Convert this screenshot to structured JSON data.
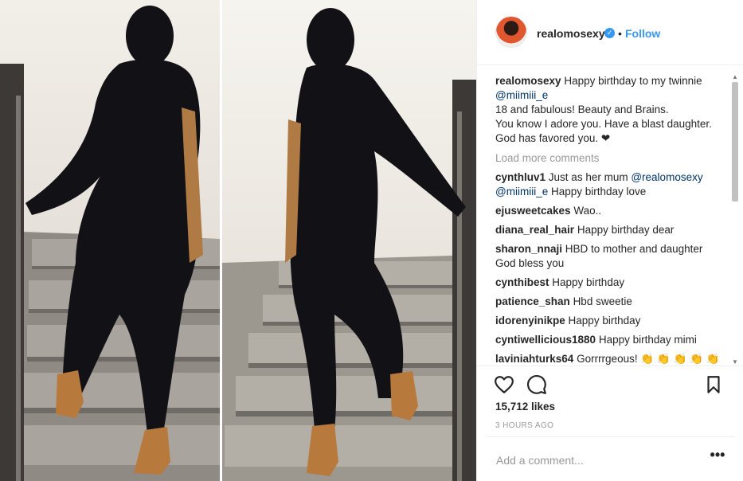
{
  "post": {
    "username": "realomosexy",
    "follow_label": "Follow",
    "separator": "•",
    "verified_glyph": "✓",
    "icons": {
      "avatar": "avatar",
      "verified": "verified-badge-icon",
      "like": "heart-icon",
      "comment": "comment-bubble-icon",
      "save": "bookmark-icon",
      "more": "more-options-icon"
    },
    "caption": {
      "username": "realomosexy",
      "text_1": "Happy birthday to my twinnie",
      "mention": "@miimiii_e",
      "text_2": "18 and fabulous! Beauty and Brains.",
      "text_3": "You know I adore you. Have a blast daughter. God has favored you. ❤"
    },
    "load_more_label": "Load more comments",
    "comments": [
      {
        "user": "cynthluv1",
        "text_1": "Just as her mum",
        "mention_1": "@realomosexy",
        "mention_2": "@miimiii_e",
        "text_2": "Happy birthday love"
      },
      {
        "user": "ejusweetcakes",
        "text": "Wao.."
      },
      {
        "user": "diana_real_hair",
        "text": "Happy birthday dear"
      },
      {
        "user": "sharon_nnaji",
        "text": "HBD to mother and daughter God bless you"
      },
      {
        "user": "cynthibest",
        "text": "Happy birthday"
      },
      {
        "user": "patience_shan",
        "text": "Hbd sweetie"
      },
      {
        "user": "idorenyinikpe",
        "text": "Happy birthday"
      },
      {
        "user": "cyntiwellicious1880",
        "text": "Happy birthday mimi"
      },
      {
        "user": "laviniahturks64",
        "text": "Gorrrrgeous! 👏 👏 👏 👏 👏"
      }
    ],
    "likes": "15,712 likes",
    "time": "3 HOURS AGO",
    "add_comment_placeholder": "Add a comment...",
    "more_glyph": "•••",
    "scroll_up": "▲",
    "scroll_down": "▼"
  },
  "colors": {
    "link_blue": "#3897f0",
    "mention_navy": "#003569",
    "muted_gray": "#999999"
  }
}
